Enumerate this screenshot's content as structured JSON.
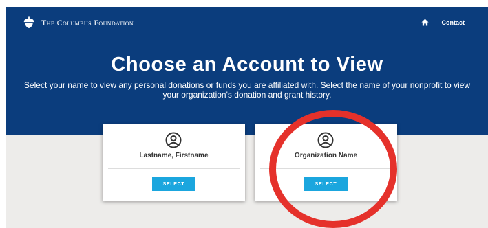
{
  "header": {
    "logo_text": "The Columbus Foundation",
    "nav": {
      "contact_label": "Contact"
    }
  },
  "hero": {
    "title": "Choose an Account to View",
    "subtitle": "Select your name to view any personal donations or funds you are affiliated with. Select the name of your nonprofit to view your organization's donation and grant history."
  },
  "accounts": [
    {
      "name": "Lastname, Firstname",
      "button_label": "SELECT"
    },
    {
      "name": "Organization Name",
      "button_label": "SELECT"
    }
  ],
  "colors": {
    "hero_bg": "#0b3d7d",
    "page_bg": "#edecea",
    "button_bg": "#1ba6de",
    "highlight_ring": "#e5312b"
  }
}
